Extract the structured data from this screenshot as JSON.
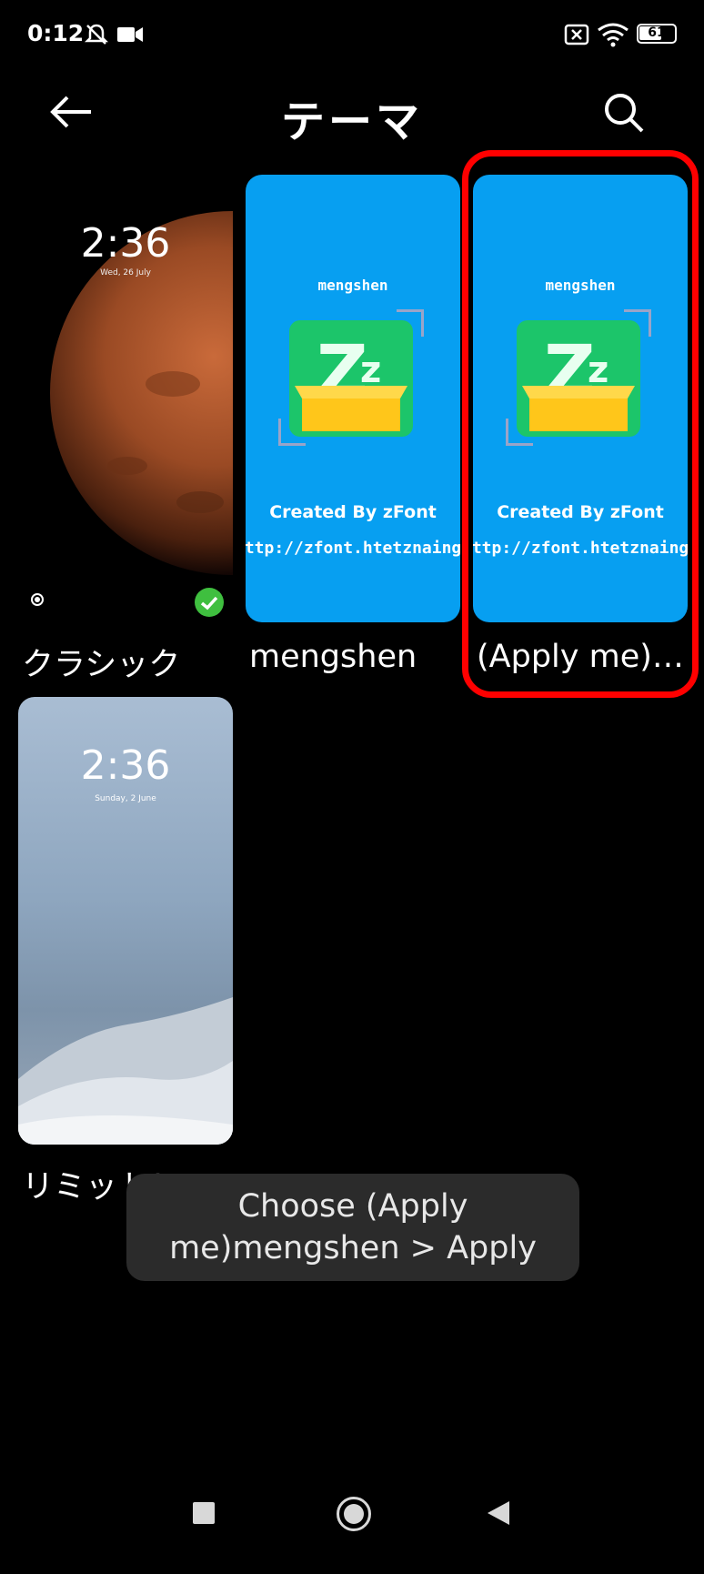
{
  "status": {
    "time": "0:12",
    "battery": "61"
  },
  "header": {
    "title": "テーマ"
  },
  "themes": [
    {
      "name": "クラシック",
      "clock": "2:36",
      "date": "Wed, 26 July"
    },
    {
      "name": "mengshen",
      "thumb_top": "mengshen",
      "thumb_created": "Created By zFont",
      "thumb_url": "http://zfont.htetznaing.com"
    },
    {
      "name": "(Apply me)m...",
      "thumb_top": "mengshen",
      "thumb_created": "Created By zFont",
      "thumb_url": "http://zfont.htetznaing.com"
    },
    {
      "name": "リミットレス",
      "clock": "2:36",
      "date": "Sunday, 2 June"
    }
  ],
  "toast": {
    "text": "Choose (Apply me)mengshen > Apply"
  },
  "colors": {
    "accent_blue": "#079ff1",
    "highlight_red": "#ff0000",
    "check_green": "#3fbf3f"
  }
}
